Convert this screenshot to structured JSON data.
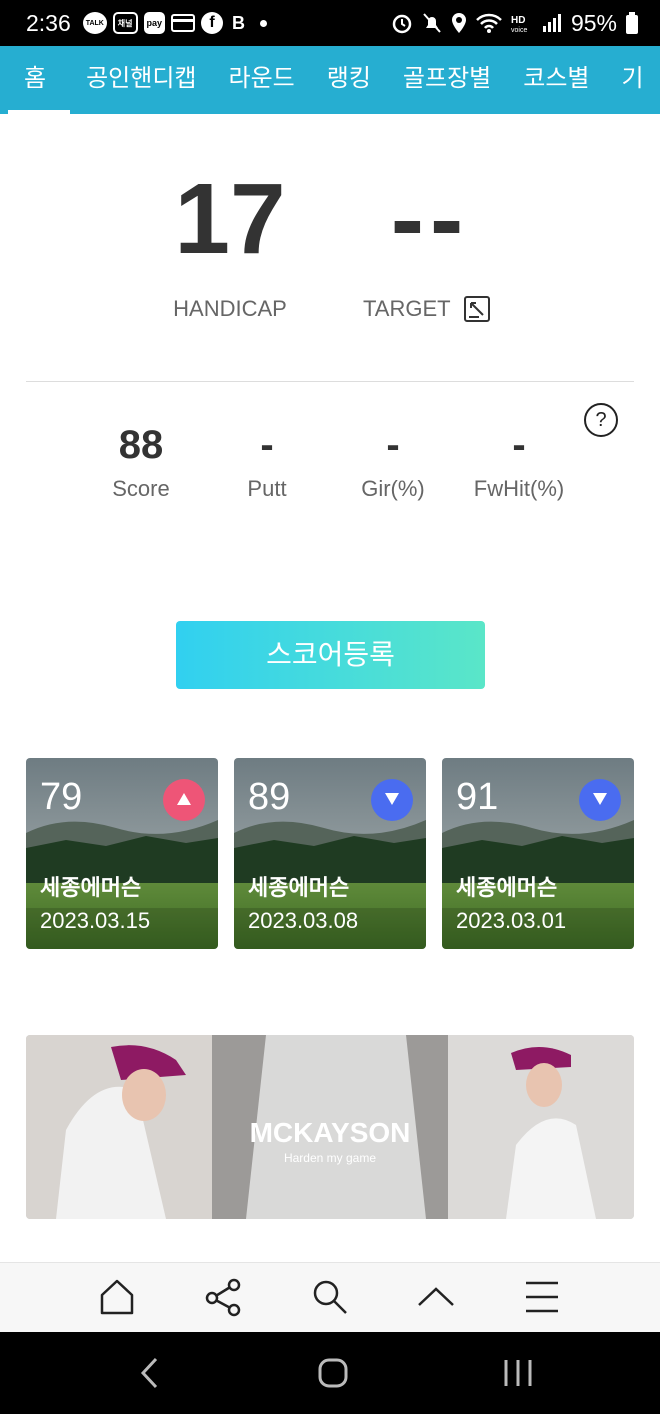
{
  "status": {
    "time": "2:36",
    "icons_left": [
      "TALK",
      "채널",
      "pay"
    ],
    "battery": "95%"
  },
  "tabs": [
    "홈",
    "공인핸디캡",
    "라운드",
    "랭킹",
    "골프장별",
    "코스별",
    "기"
  ],
  "handicap": {
    "value": "17",
    "label": "HANDICAP"
  },
  "target": {
    "value": "--",
    "label": "TARGET"
  },
  "stats": [
    {
      "value": "88",
      "label": "Score"
    },
    {
      "value": "-",
      "label": "Putt"
    },
    {
      "value": "-",
      "label": "Gir(%)"
    },
    {
      "value": "-",
      "label": "FwHit(%)"
    }
  ],
  "register_button": "스코어등록",
  "rounds": [
    {
      "score": "79",
      "trend": "up",
      "course": "세종에머슨",
      "date": "2023.03.15"
    },
    {
      "score": "89",
      "trend": "down",
      "course": "세종에머슨",
      "date": "2023.03.08"
    },
    {
      "score": "91",
      "trend": "down",
      "course": "세종에머슨",
      "date": "2023.03.01"
    }
  ],
  "banner": {
    "brand": "MCKAYSON",
    "tagline": "Harden my game"
  },
  "colors": {
    "tabbar": "#26aed1",
    "up": "#ee5577",
    "down": "#4a6cf0"
  }
}
